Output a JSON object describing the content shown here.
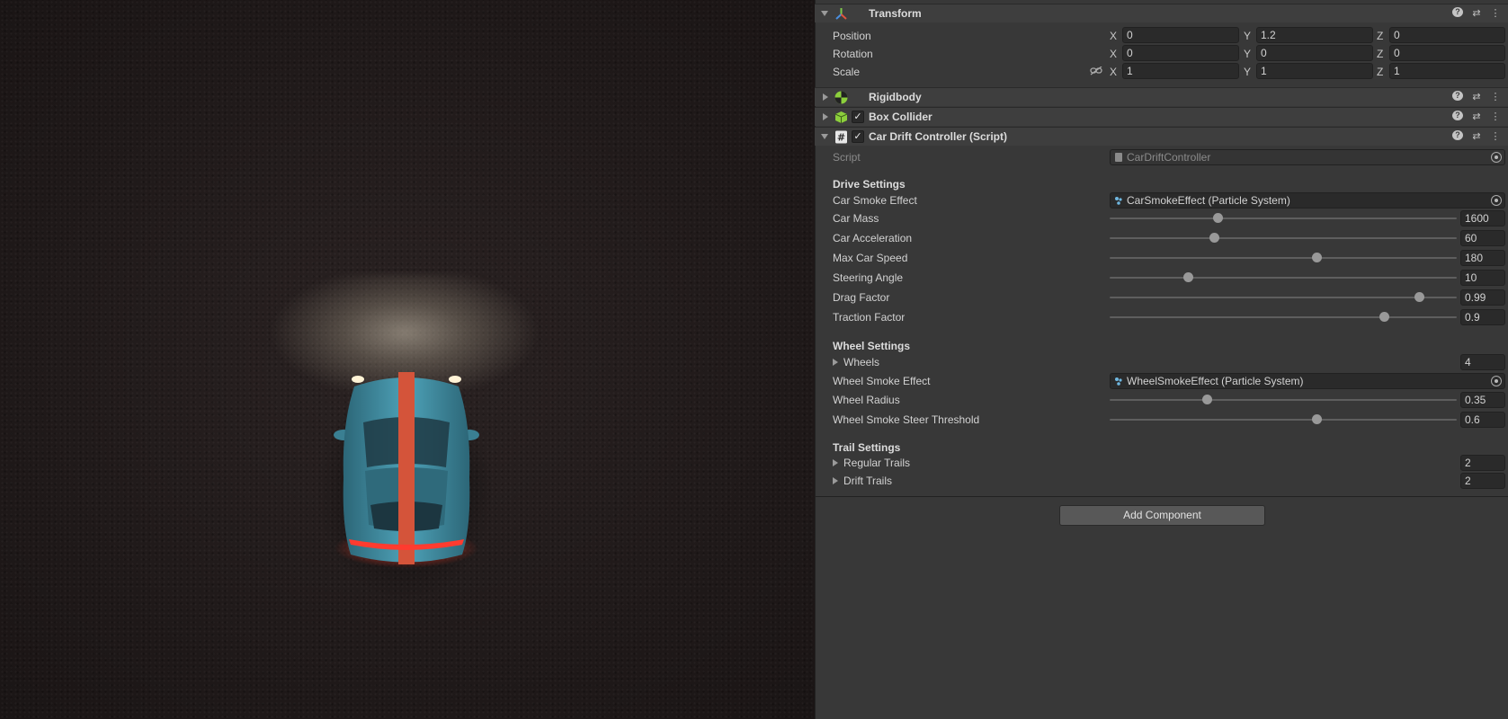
{
  "transform": {
    "title": "Transform",
    "position": {
      "label": "Position",
      "x": "0",
      "y": "1.2",
      "z": "0"
    },
    "rotation": {
      "label": "Rotation",
      "x": "0",
      "y": "0",
      "z": "0"
    },
    "scale": {
      "label": "Scale",
      "x": "1",
      "y": "1",
      "z": "1"
    },
    "axis": {
      "x": "X",
      "y": "Y",
      "z": "Z"
    }
  },
  "rigidbody": {
    "title": "Rigidbody"
  },
  "box_collider": {
    "title": "Box Collider",
    "enabled": "✓"
  },
  "car_drift": {
    "title": "Car Drift Controller (Script)",
    "enabled": "✓",
    "script_label": "Script",
    "script_value": "CarDriftController",
    "drive_settings": "Drive Settings",
    "car_smoke_effect": {
      "label": "Car Smoke Effect",
      "value": "CarSmokeEffect (Particle System)"
    },
    "car_mass": {
      "label": "Car Mass",
      "value": "1600",
      "fraction": 0.31
    },
    "car_acceleration": {
      "label": "Car Acceleration",
      "value": "60",
      "fraction": 0.3
    },
    "max_car_speed": {
      "label": "Max Car Speed",
      "value": "180",
      "fraction": 0.595
    },
    "steering_angle": {
      "label": "Steering Angle",
      "value": "10",
      "fraction": 0.225
    },
    "drag_factor": {
      "label": "Drag Factor",
      "value": "0.99",
      "fraction": 0.89
    },
    "traction_factor": {
      "label": "Traction Factor",
      "value": "0.9",
      "fraction": 0.79
    },
    "wheel_settings": "Wheel Settings",
    "wheels": {
      "label": "Wheels",
      "value": "4"
    },
    "wheel_smoke_effect": {
      "label": "Wheel Smoke Effect",
      "value": "WheelSmokeEffect (Particle System)"
    },
    "wheel_radius": {
      "label": "Wheel Radius",
      "value": "0.35",
      "fraction": 0.28
    },
    "wheel_smoke_threshold": {
      "label": "Wheel Smoke Steer Threshold",
      "value": "0.6",
      "fraction": 0.595
    },
    "trail_settings": "Trail Settings",
    "regular_trails": {
      "label": "Regular Trails",
      "value": "2"
    },
    "drift_trails": {
      "label": "Drift Trails",
      "value": "2"
    }
  },
  "add_component": "Add Component",
  "header_icons": {
    "help": "?",
    "presets": "⇄",
    "menu": "⋮"
  },
  "colors": {
    "car_body": "#3f8fa6",
    "car_stripe": "#d4543a",
    "tail_light": "#ff3b2f",
    "inspector_bg": "#383838"
  }
}
